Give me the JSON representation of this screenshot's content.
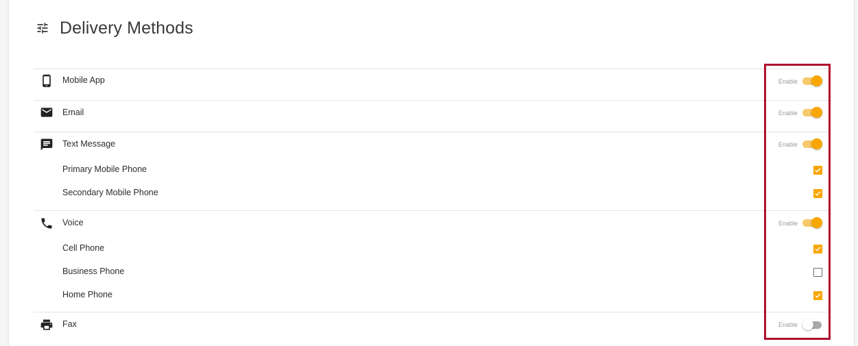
{
  "page": {
    "title": "Delivery Methods",
    "header_icon": "tune-icon"
  },
  "enable_text": "Enable",
  "methods": [
    {
      "label": "Mobile App",
      "icon": "smartphone-icon",
      "enabled": true
    },
    {
      "label": "Email",
      "icon": "email-icon",
      "enabled": true
    },
    {
      "label": "Text Message",
      "icon": "message-icon",
      "enabled": true,
      "options": [
        {
          "label": "Primary Mobile Phone",
          "checked": true
        },
        {
          "label": "Secondary Mobile Phone",
          "checked": true
        }
      ]
    },
    {
      "label": "Voice",
      "icon": "phone-icon",
      "enabled": true,
      "options": [
        {
          "label": "Cell Phone",
          "checked": true
        },
        {
          "label": "Business Phone",
          "checked": false
        },
        {
          "label": "Home Phone",
          "checked": true
        }
      ]
    },
    {
      "label": "Fax",
      "icon": "printer-icon",
      "enabled": false
    }
  ],
  "colors": {
    "accent": "#f9a600",
    "accent_light": "#f7c96b",
    "highlight_border": "#b00d2e"
  }
}
